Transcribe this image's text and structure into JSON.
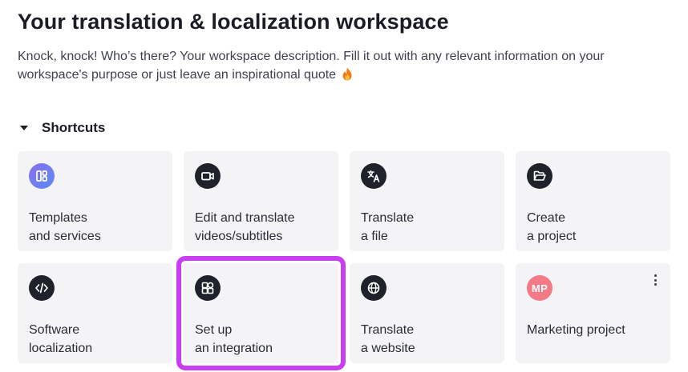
{
  "header": {
    "title": "Your translation & localization workspace",
    "description": "Knock, knock! Who’s there? Your workspace description. Fill it out with any relevant information on your workspace's purpose or just leave an inspirational quote",
    "description_emoji": "fire-icon"
  },
  "shortcuts": {
    "section_label": "Shortcuts",
    "collapse_icon": "caret-down-icon",
    "cards": [
      {
        "line1": "Templates",
        "line2": "and services",
        "icon": "templates-icon"
      },
      {
        "line1": "Edit and translate",
        "line2": "videos/subtitles",
        "icon": "video-camera-icon"
      },
      {
        "line1": "Translate",
        "line2": "a file",
        "icon": "translate-icon"
      },
      {
        "line1": "Create",
        "line2": "a project",
        "icon": "folder-open-icon"
      },
      {
        "line1": "Software",
        "line2": "localization",
        "icon": "code-icon"
      },
      {
        "line1": "Set up",
        "line2": "an integration",
        "icon": "integration-icon"
      },
      {
        "line1": "Translate",
        "line2": "a website",
        "icon": "globe-icon"
      },
      {
        "line1": "Marketing project",
        "line2": "",
        "avatar_text": "MP",
        "icon": "more-vertical-icon"
      }
    ]
  },
  "colors": {
    "highlight": "#c83ef0",
    "card_bg": "#f4f4f7",
    "icon_bg": "#20222b",
    "avatar_bg": "#f47a87"
  }
}
